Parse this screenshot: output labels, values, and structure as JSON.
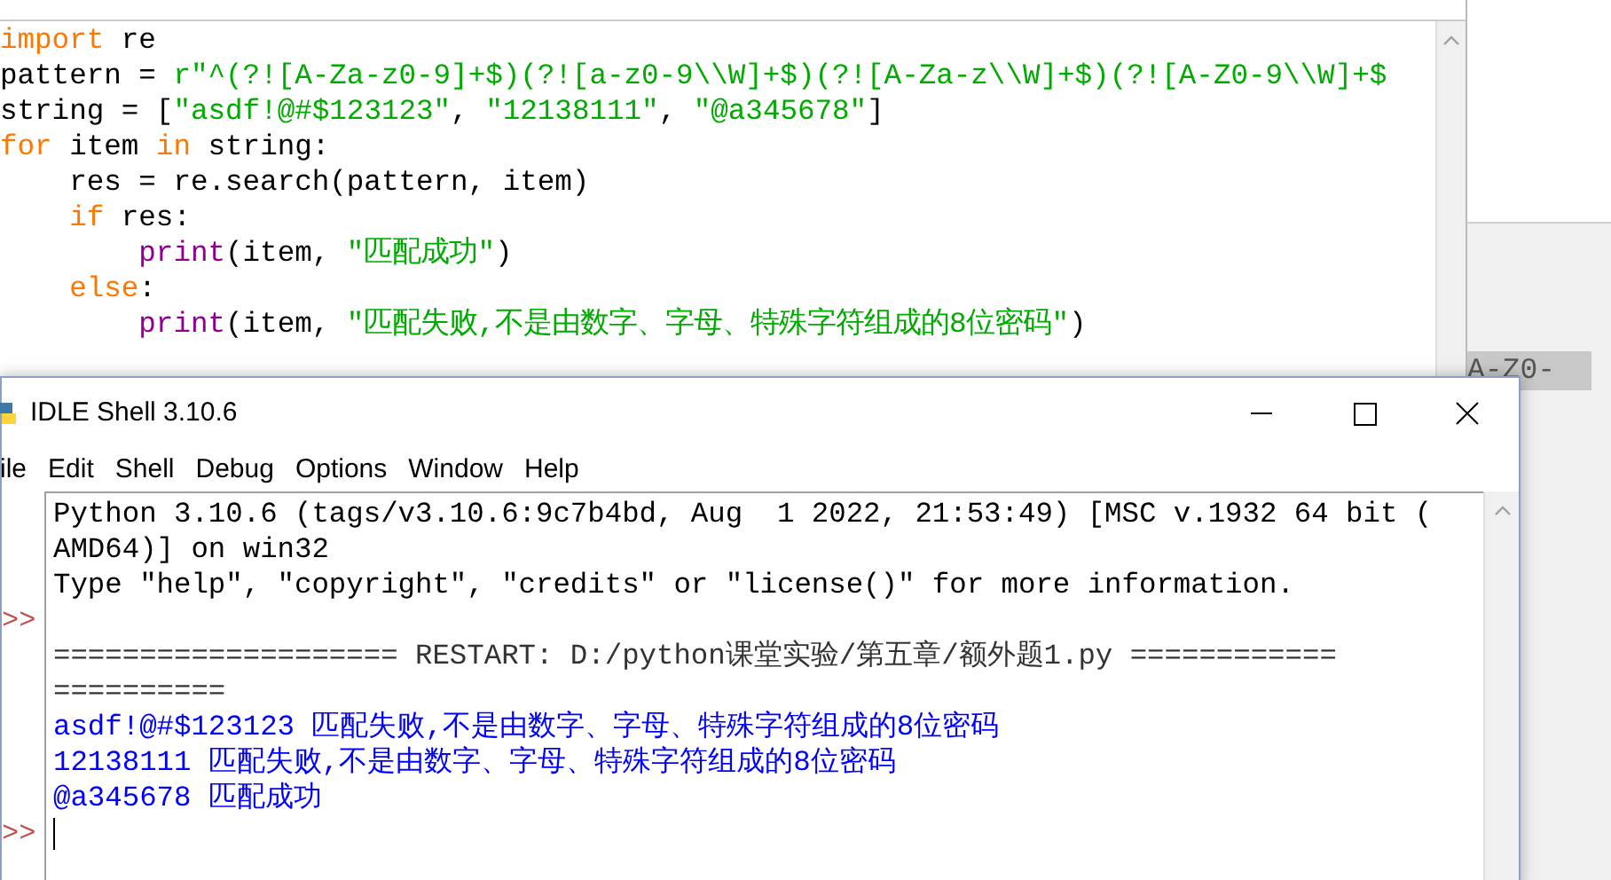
{
  "editor": {
    "code_lines": [
      [
        {
          "text": "import",
          "kind": "keyword"
        },
        {
          "text": " re",
          "kind": "plain"
        }
      ],
      [
        {
          "text": "pattern = ",
          "kind": "plain"
        },
        {
          "text": "r\"^(?![A-Za-z0-9]+$)(?![a-z0-9\\\\W]+$)(?![A-Za-z\\\\W]+$)(?![A-Z0-9\\\\W]+$",
          "kind": "string"
        }
      ],
      [
        {
          "text": "string = [",
          "kind": "plain"
        },
        {
          "text": "\"asdf!@#$123123\"",
          "kind": "string"
        },
        {
          "text": ", ",
          "kind": "plain"
        },
        {
          "text": "\"12138111\"",
          "kind": "string"
        },
        {
          "text": ", ",
          "kind": "plain"
        },
        {
          "text": "\"@a345678\"",
          "kind": "string"
        },
        {
          "text": "]",
          "kind": "plain"
        }
      ],
      [
        {
          "text": "for",
          "kind": "keyword"
        },
        {
          "text": " item ",
          "kind": "plain"
        },
        {
          "text": "in",
          "kind": "keyword"
        },
        {
          "text": " string:",
          "kind": "plain"
        }
      ],
      [
        {
          "text": "    res = re.search(pattern, item)",
          "kind": "plain"
        }
      ],
      [
        {
          "text": "    if",
          "kind": "keyword"
        },
        {
          "text": " res:",
          "kind": "plain"
        }
      ],
      [
        {
          "text": "        print",
          "kind": "builtin"
        },
        {
          "text": "(item, ",
          "kind": "plain"
        },
        {
          "text": "\"匹配成功\"",
          "kind": "string"
        },
        {
          "text": ")",
          "kind": "plain"
        }
      ],
      [
        {
          "text": "    else",
          "kind": "keyword"
        },
        {
          "text": ":",
          "kind": "plain"
        }
      ],
      [
        {
          "text": "        print",
          "kind": "builtin"
        },
        {
          "text": "(item, ",
          "kind": "plain"
        },
        {
          "text": "\"匹配失败,不是由数字、字母、特殊字符组成的8位密码\"",
          "kind": "string"
        },
        {
          "text": ")",
          "kind": "plain"
        }
      ]
    ]
  },
  "background_window": {
    "text": "A-Z0-"
  },
  "shell": {
    "title": "IDLE Shell 3.10.6",
    "menu": [
      "ile",
      "Edit",
      "Shell",
      "Debug",
      "Options",
      "Window",
      "Help"
    ],
    "lines": [
      {
        "text": "Python 3.10.6 (tags/v3.10.6:9c7b4bd, Aug  1 2022, 21:53:49) [MSC v.1932 64 bit (",
        "kind": "plain"
      },
      {
        "text": "AMD64)] on win32",
        "kind": "plain"
      },
      {
        "text": "Type \"help\", \"copyright\", \"credits\" or \"license()\" for more information.",
        "kind": "plain"
      },
      {
        "gutter": ">>"
      },
      {
        "text": "==================== RESTART: D:/python课堂实验/第五章/额外题1.py ============",
        "kind": "restart"
      },
      {
        "text": "==========",
        "kind": "restart"
      },
      {
        "text": "asdf!@#$123123 匹配失败,不是由数字、字母、特殊字符组成的8位密码",
        "kind": "output"
      },
      {
        "text": "12138111 匹配失败,不是由数字、字母、特殊字符组成的8位密码",
        "kind": "output"
      },
      {
        "text": "@a345678 匹配成功",
        "kind": "output"
      },
      {
        "gutter": ">>",
        "cursor": true
      }
    ]
  }
}
